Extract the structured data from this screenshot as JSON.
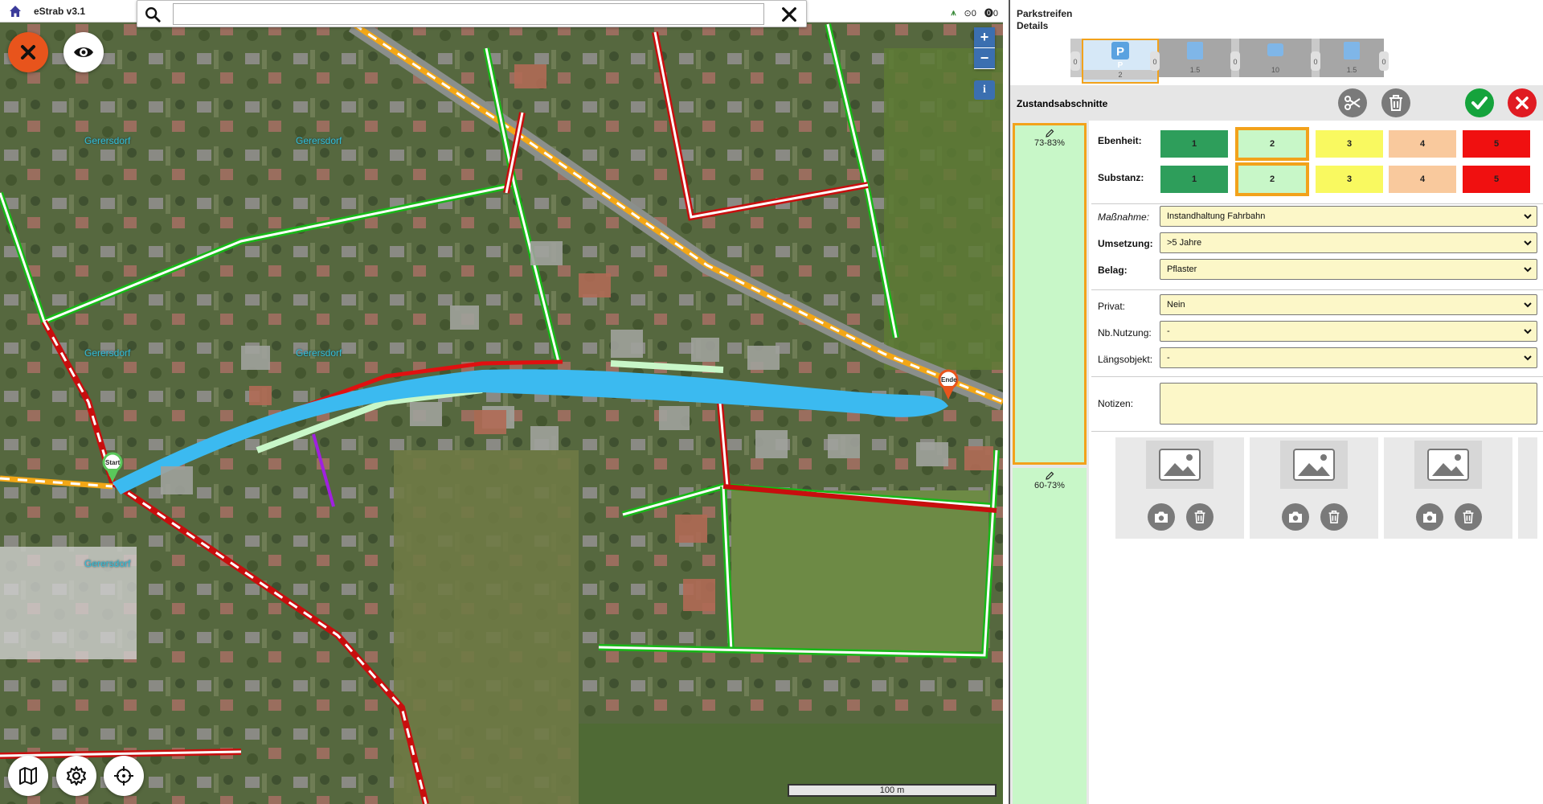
{
  "app": {
    "title": "eStrab v3.1"
  },
  "search": {
    "placeholder": "",
    "value": ""
  },
  "status": {
    "count_a": "0",
    "count_b": "0"
  },
  "map": {
    "places": [
      "Gerersdorf",
      "Gerersdorf",
      "Gerersdorf",
      "Gerersdorf",
      "Gerersdorf"
    ],
    "marker_start": "Start",
    "marker_end": "Ende",
    "scale_label": "100 m",
    "zoom_in": "+",
    "zoom_out": "−",
    "info": "i"
  },
  "panel": {
    "title": "Parkstreifen",
    "subtitle": "Details",
    "strip": {
      "first_code": "P",
      "labels": [
        "2",
        "1.5",
        "10",
        "1.5"
      ],
      "separators": [
        "0",
        "0",
        "0",
        "0",
        "0"
      ]
    },
    "section_label": "Zustandsabschnitte",
    "segments": [
      {
        "label": "73-83%"
      },
      {
        "label": "60-73%"
      }
    ],
    "form": {
      "ebenheit_label": "Ebenheit:",
      "substanz_label": "Substanz:",
      "ratings": [
        "1",
        "2",
        "3",
        "4",
        "5"
      ],
      "ebenheit_selected": "2",
      "substanz_selected": "2",
      "massnahme_label": "Maßnahme:",
      "massnahme_value": "Instandhaltung Fahrbahn",
      "umsetzung_label": "Umsetzung:",
      "umsetzung_value": ">5 Jahre",
      "belag_label": "Belag:",
      "belag_value": "Pflaster",
      "privat_label": "Privat:",
      "privat_value": "Nein",
      "nbnutzung_label": "Nb.Nutzung:",
      "nbnutzung_value": "-",
      "laengsobjekt_label": "Längsobjekt:",
      "laengsobjekt_value": "-",
      "notizen_label": "Notizen:",
      "notizen_value": ""
    }
  },
  "colors": {
    "accent_orange": "#f2a21b",
    "close_orange": "#e8541c",
    "rating_1": "#2e9e5b",
    "rating_2": "#c8f7c8",
    "rating_3": "#f9f960",
    "rating_4": "#f9c99d",
    "rating_5": "#f01010",
    "road_highlight": "#3bbaf0",
    "confirm_green": "#15a33c",
    "cancel_red": "#e01b22"
  },
  "icons": [
    "home-icon",
    "search-icon",
    "close-icon",
    "eye-icon",
    "map-icon",
    "gear-icon",
    "crosshair-icon",
    "scissors-icon",
    "trash-icon",
    "check-icon",
    "pencil-icon",
    "image-icon",
    "camera-icon",
    "parking-icon",
    "chevron-down-icon"
  ]
}
